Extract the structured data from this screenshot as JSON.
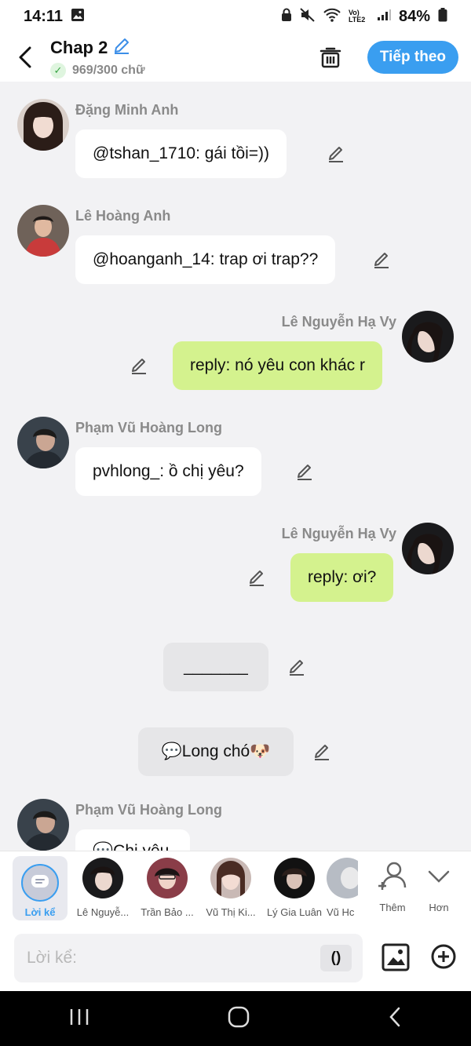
{
  "status_bar": {
    "time": "14:11",
    "battery": "84%",
    "network": "Vo) LTE2"
  },
  "header": {
    "title": "Chap 2",
    "word_count": "969/300 chữ",
    "next_label": "Tiếp theo"
  },
  "messages": [
    {
      "sender": "Đặng Minh Anh",
      "text": "@tshan_1710: gái tồi=))",
      "side": "left"
    },
    {
      "sender": "Lê Hoàng Anh",
      "text": "@hoanganh_14: trap ơi trap??",
      "side": "left"
    },
    {
      "sender": "Lê Nguyễn Hạ Vy",
      "text": "reply: nó yêu con khác r",
      "side": "right"
    },
    {
      "sender": "Phạm Vũ Hoàng Long",
      "text": "pvhlong_: ồ chị yêu?",
      "side": "left"
    },
    {
      "sender": "Lê Nguyễn Hạ Vy",
      "text": "reply: ơi?",
      "side": "right"
    },
    {
      "sender": "",
      "text": "_______",
      "side": "narration"
    },
    {
      "sender": "",
      "text": "💬Long chó🐶",
      "side": "narration"
    },
    {
      "sender": "Phạm Vũ Hoàng Long",
      "text": "💬Chị yêu",
      "side": "left"
    }
  ],
  "character_bar": {
    "narrator_label": "Lời kể",
    "characters": [
      "Lê Nguyễ...",
      "Trần Bảo ...",
      "Vũ Thị Ki...",
      "Lý Gia Luân",
      "Vũ Hc"
    ],
    "add_label": "Thêm",
    "more_label": "Hơn"
  },
  "input": {
    "placeholder": "Lời kể:",
    "paren_label": "()"
  },
  "colors": {
    "accent": "#3a9ef0",
    "right_bubble": "#d4f28e",
    "background": "#f2f2f4"
  }
}
